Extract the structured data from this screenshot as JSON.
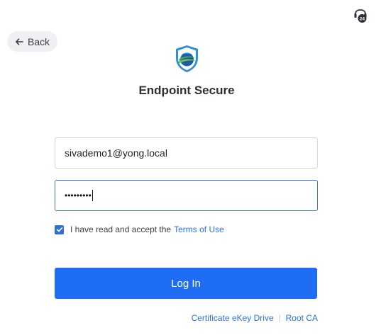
{
  "header": {
    "back_label": "Back",
    "support_icon": "support-24-icon"
  },
  "app": {
    "title": "Endpoint Secure",
    "logo_icon": "endpoint-secure-shield-logo"
  },
  "form": {
    "email_value": "sivademo1@yong.local",
    "password_masked": "•••••••••",
    "terms_checked": true,
    "terms_text": "I have read and accept the",
    "terms_link": "Terms of Use",
    "login_label": "Log In"
  },
  "footer": {
    "certificate_link": "Certificate eKey Drive",
    "root_ca_link": "Root CA"
  },
  "colors": {
    "primary": "#1f6cf5",
    "link": "#2e6fe0",
    "back_bg": "#eef0f3"
  }
}
